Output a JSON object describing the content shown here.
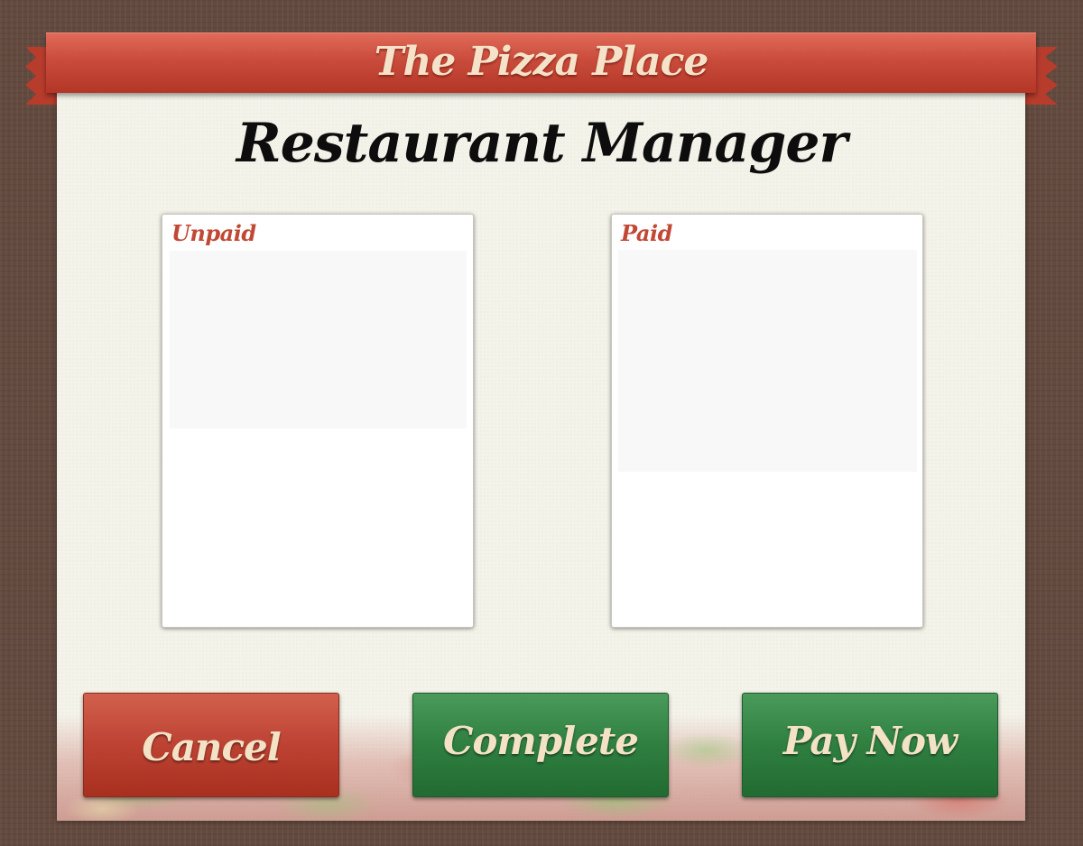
{
  "header": {
    "brand": "The Pizza Place"
  },
  "page": {
    "title": "Restaurant Manager"
  },
  "lists": {
    "unpaid": {
      "label": "Unpaid",
      "items": []
    },
    "paid": {
      "label": "Paid",
      "items": []
    }
  },
  "actions": {
    "cancel_label": "Cancel",
    "complete_label": "Complete",
    "pay_now_label": "Pay Now"
  },
  "colors": {
    "background": "#634a3f",
    "ribbon": "#c94b3b",
    "panel": "#f4f3ea",
    "cancel": "#bd4233",
    "confirm": "#2f7f40",
    "label_accent": "#c24836",
    "label_text": "#f3e2c6"
  }
}
